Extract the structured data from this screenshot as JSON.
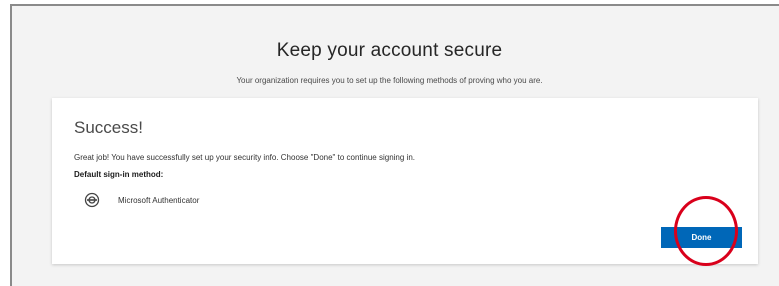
{
  "header": {
    "title": "Keep your account secure",
    "subtitle": "Your organization requires you to set up the following methods of proving who you are."
  },
  "card": {
    "title": "Success!",
    "message": "Great job! You have successfully set up your security info. Choose \"Done\" to continue signing in.",
    "default_method_label": "Default sign-in method:",
    "method": {
      "icon": "authenticator-icon",
      "label": "Microsoft Authenticator"
    }
  },
  "actions": {
    "done_label": "Done"
  },
  "colors": {
    "primary": "#0067b8",
    "highlight": "#d9001b",
    "background": "#f3f3f3"
  }
}
